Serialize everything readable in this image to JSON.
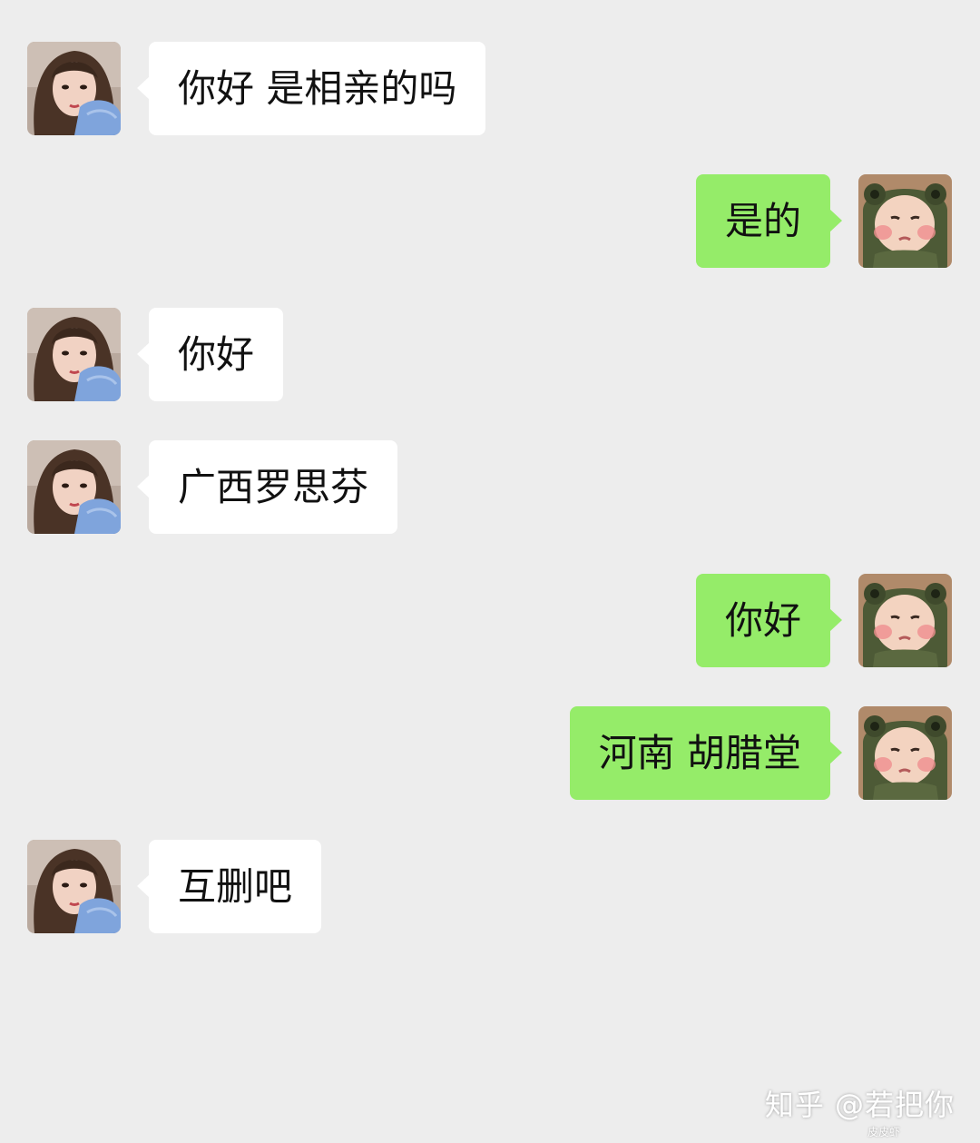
{
  "messages": [
    {
      "side": "left",
      "text": "你好 是相亲的吗"
    },
    {
      "side": "right",
      "text": "是的"
    },
    {
      "side": "left",
      "text": "你好"
    },
    {
      "side": "left",
      "text": "广西罗思芬"
    },
    {
      "side": "right",
      "text": "你好"
    },
    {
      "side": "right",
      "text": "河南 胡腊堂"
    },
    {
      "side": "left",
      "text": "互删吧"
    }
  ],
  "watermark": {
    "main": "知乎 @若把你",
    "small": "皮皮虾"
  },
  "colors": {
    "background": "#ededed",
    "left_bubble": "#ffffff",
    "right_bubble": "#95ec69"
  },
  "avatars": {
    "left": "girl-avatar",
    "right": "baby-frog-hat-avatar"
  }
}
